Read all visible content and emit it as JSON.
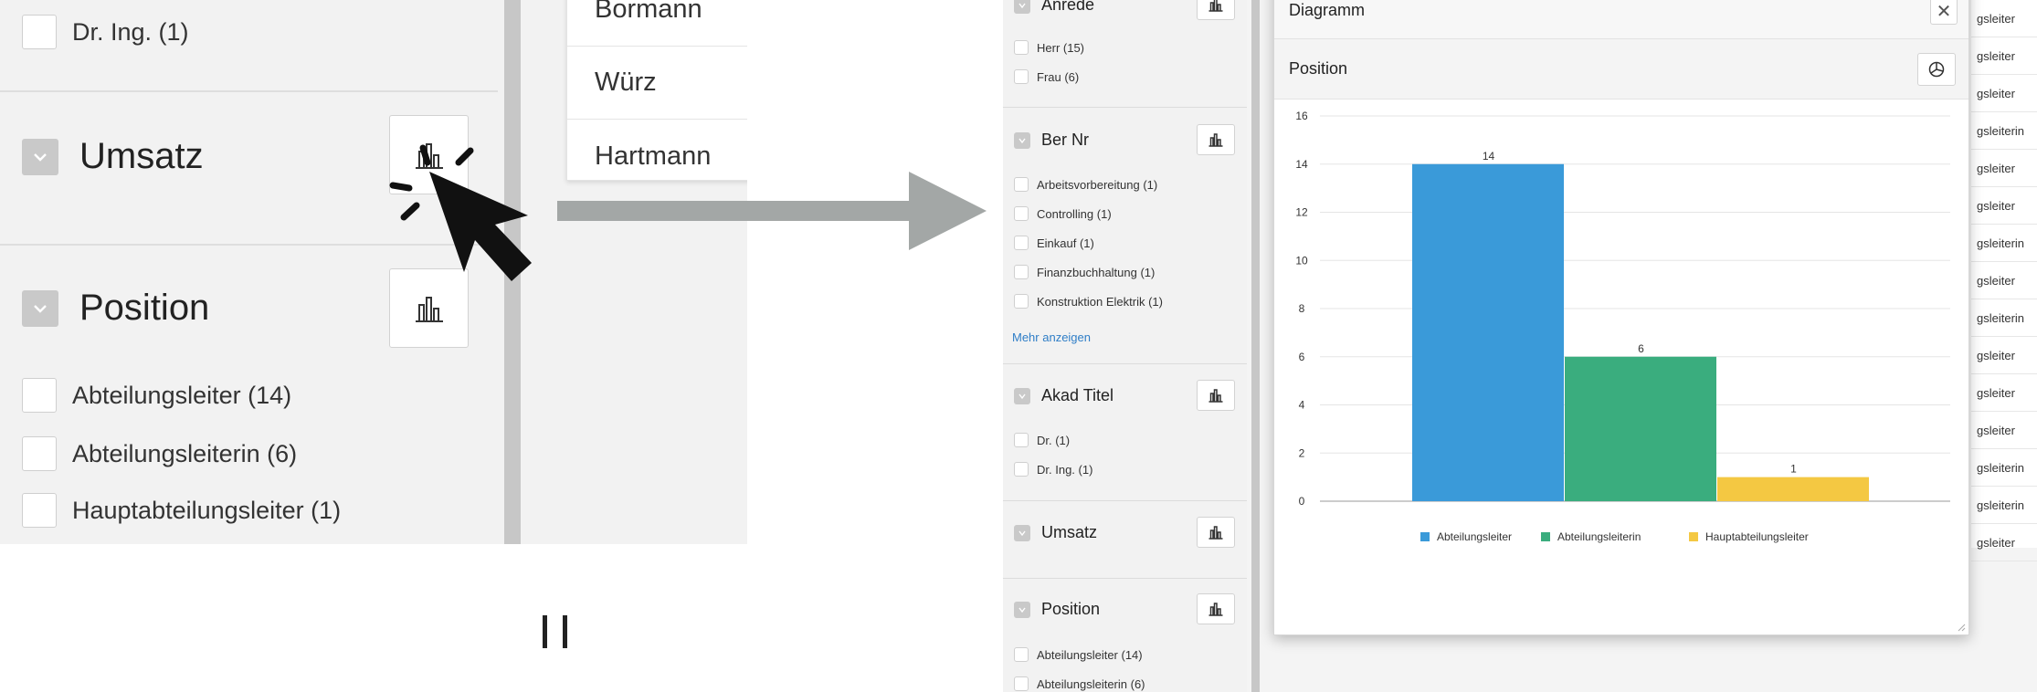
{
  "zoom": {
    "facet_rows_top": [
      "Dr. Ing. (1)"
    ],
    "umsatz_label": "Umsatz",
    "position_label": "Position",
    "position_items": [
      "Abteilungsleiter (14)",
      "Abteilungsleiterin (6)",
      "Hauptabteilungsleiter (1)"
    ],
    "results": [
      "Bormann",
      "Würz",
      "Hartmann"
    ]
  },
  "sidebar": {
    "anrede": {
      "label": "Anrede",
      "items": [
        "Herr (15)",
        "Frau (6)"
      ]
    },
    "ber_nr": {
      "label": "Ber Nr",
      "items": [
        "Arbeitsvorbereitung (1)",
        "Controlling (1)",
        "Einkauf (1)",
        "Finanzbuchhaltung (1)",
        "Konstruktion Elektrik (1)"
      ],
      "more": "Mehr anzeigen"
    },
    "akad_titel": {
      "label": "Akad Titel",
      "items": [
        "Dr. (1)",
        "Dr. Ing. (1)"
      ]
    },
    "umsatz": {
      "label": "Umsatz"
    },
    "position": {
      "label": "Position",
      "items": [
        "Abteilungsleiter (14)",
        "Abteilungsleiterin (6)"
      ]
    }
  },
  "dialog": {
    "title": "Diagramm",
    "subtitle": "Position",
    "close_symbol": "✕"
  },
  "result_list": [
    "gsleiter",
    "gsleiter",
    "gsleiter",
    "gsleiterin",
    "gsleiter",
    "gsleiter",
    "gsleiterin",
    "gsleiter",
    "gsleiterin",
    "gsleiter",
    "gsleiter",
    "gsleiter",
    "gsleiterin",
    "gsleiterin",
    "gsleiter"
  ],
  "colors": {
    "blue": "#3a9ad9",
    "green": "#3aad7e",
    "yellow": "#f4c842",
    "link": "#2f7ec7",
    "arrow": "#a3a7a6"
  },
  "icons": [
    "bar-chart-icon",
    "pie-chart-icon",
    "close-icon",
    "mouse-cursor-icon",
    "click-burst-icon",
    "right-arrow-icon",
    "pause-icon"
  ],
  "chart_data": {
    "type": "bar",
    "categories": [
      "Abteilungsleiter",
      "Abteilungsleiterin",
      "Hauptabteilungsleiter"
    ],
    "values": [
      14,
      6,
      1
    ],
    "colors": [
      "#3a9ad9",
      "#3aad7e",
      "#f4c842"
    ],
    "title": "",
    "xlabel": "",
    "ylabel": "",
    "ylim": [
      0,
      16
    ],
    "yticks": [
      0,
      2,
      4,
      6,
      8,
      10,
      12,
      14,
      16
    ],
    "grid": true,
    "legend": "bottom"
  }
}
